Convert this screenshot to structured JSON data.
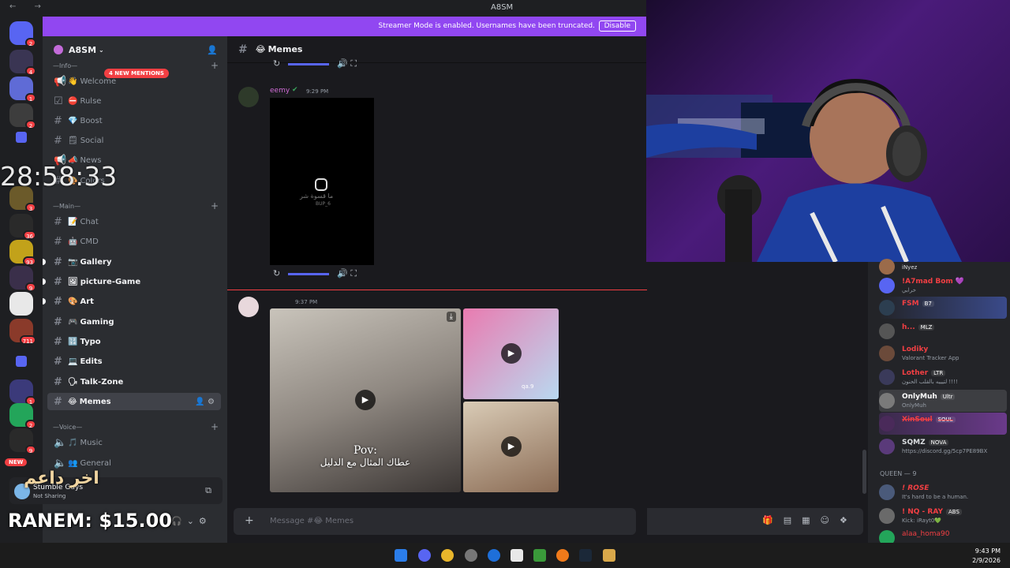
{
  "window": {
    "title": "A8SM",
    "nav_arrows": "← →"
  },
  "server_rail": {
    "badges": [
      "2",
      "4",
      "1",
      "2",
      "3",
      "36",
      "93",
      "9",
      "711",
      "1",
      "2",
      "9"
    ],
    "new_label": "NEW"
  },
  "banner": {
    "message": "Streamer Mode is enabled. Usernames have been truncated.",
    "disable_label": "Disable"
  },
  "server": {
    "name": "A8SM",
    "mentions": "4 NEW MENTIONS",
    "categories": [
      "—Info—",
      "—Main—",
      "—Voice—"
    ],
    "channels": [
      {
        "emoji": "👋",
        "name": "Welcome",
        "kind": "announce"
      },
      {
        "emoji": "⛔",
        "name": "Rulse",
        "kind": "rules"
      },
      {
        "emoji": "💎",
        "name": "Boost",
        "kind": "text"
      },
      {
        "emoji": "🗒",
        "name": "Social",
        "kind": "text"
      },
      {
        "emoji": "📣",
        "name": "News",
        "kind": "announce"
      },
      {
        "emoji": "🎨",
        "name": "Colors",
        "kind": "text"
      },
      {
        "emoji": "📝",
        "name": "Chat",
        "kind": "text"
      },
      {
        "emoji": "🤖",
        "name": "CMD",
        "kind": "text"
      },
      {
        "emoji": "📷",
        "name": "Gallery",
        "kind": "text"
      },
      {
        "emoji": "🖼",
        "name": "picture-Game",
        "kind": "text"
      },
      {
        "emoji": "🎨",
        "name": "Art",
        "kind": "text"
      },
      {
        "emoji": "🎮",
        "name": "Gaming",
        "kind": "text"
      },
      {
        "emoji": "🔢",
        "name": "Typo",
        "kind": "text"
      },
      {
        "emoji": "💻",
        "name": "Edits",
        "kind": "text"
      },
      {
        "emoji": "🗣",
        "name": "Talk-Zone",
        "kind": "text"
      },
      {
        "emoji": "😂",
        "name": "Memes",
        "kind": "text"
      },
      {
        "emoji": "🎵",
        "name": "Music",
        "kind": "voice"
      },
      {
        "emoji": "👥",
        "name": "General",
        "kind": "voice"
      }
    ]
  },
  "overlay": {
    "timer": "28:58:33",
    "arabic": "اخر داعم",
    "ranem": "RANEM: $15.00"
  },
  "user_panel": {
    "name": "Stumble Guys",
    "status": "Not Sharing"
  },
  "channel": {
    "name": "Memes",
    "emoji": "😂"
  },
  "messages": [
    {
      "author": "eemy",
      "time": "9:29 PM",
      "video_caption": "ما قسوة شر",
      "video_handle": "BUP_6"
    },
    {
      "author": "",
      "time": "9:37 PM",
      "pov_line1": "Pov:",
      "pov_line2": "عطاك المثال مع الدليل",
      "image_tag": "qa.9"
    }
  ],
  "composer": {
    "placeholder": "Message #😂 Memes"
  },
  "members": [
    {
      "name": "iNyez",
      "tag": "",
      "status": "",
      "color": "#b5bac1"
    },
    {
      "name": "!A7mad Bom 💜",
      "tag": "",
      "status": "خرابي",
      "color": "#f23f43"
    },
    {
      "name": "FSM",
      "tag": "B7",
      "status": "",
      "color": "#f23f43"
    },
    {
      "name": "h...",
      "tag": "MLZ",
      "status": "",
      "color": "#f23f43"
    },
    {
      "name": "Lodiky",
      "tag": "",
      "status": "Valorant Tracker App",
      "color": "#f23f43"
    },
    {
      "name": "Lother",
      "tag": "LTR",
      "status": "لتيييه بالقلب الحنون !!!!",
      "color": "#f23f43"
    },
    {
      "name": "OnlyMuh",
      "tag": "Ultr",
      "status": "OnlyMuh",
      "color": "#ffffff"
    },
    {
      "name": "XinSoul",
      "tag": "SOUL",
      "status": "",
      "color": "#f23f43"
    },
    {
      "name": "SQMZ",
      "tag": "NOVA",
      "status": "https://discord.gg/5cp7PE89BX",
      "color": "#dbdee1"
    }
  ],
  "members_queen": {
    "header": "QUEEN — 9",
    "list": [
      {
        "name": "! ROSE",
        "tag": "",
        "status": "It's hard to be a human.",
        "color": "#f23f43"
      },
      {
        "name": "! NQ - RAY",
        "tag": "ABS",
        "status": "Kick: iRayt0💚",
        "color": "#f23f43"
      },
      {
        "name": "alaa_homa90",
        "tag": "",
        "status": "",
        "color": "#f23f43"
      }
    ]
  },
  "taskbar": {
    "time": "9:43 PM",
    "date": "2/9/2026"
  }
}
